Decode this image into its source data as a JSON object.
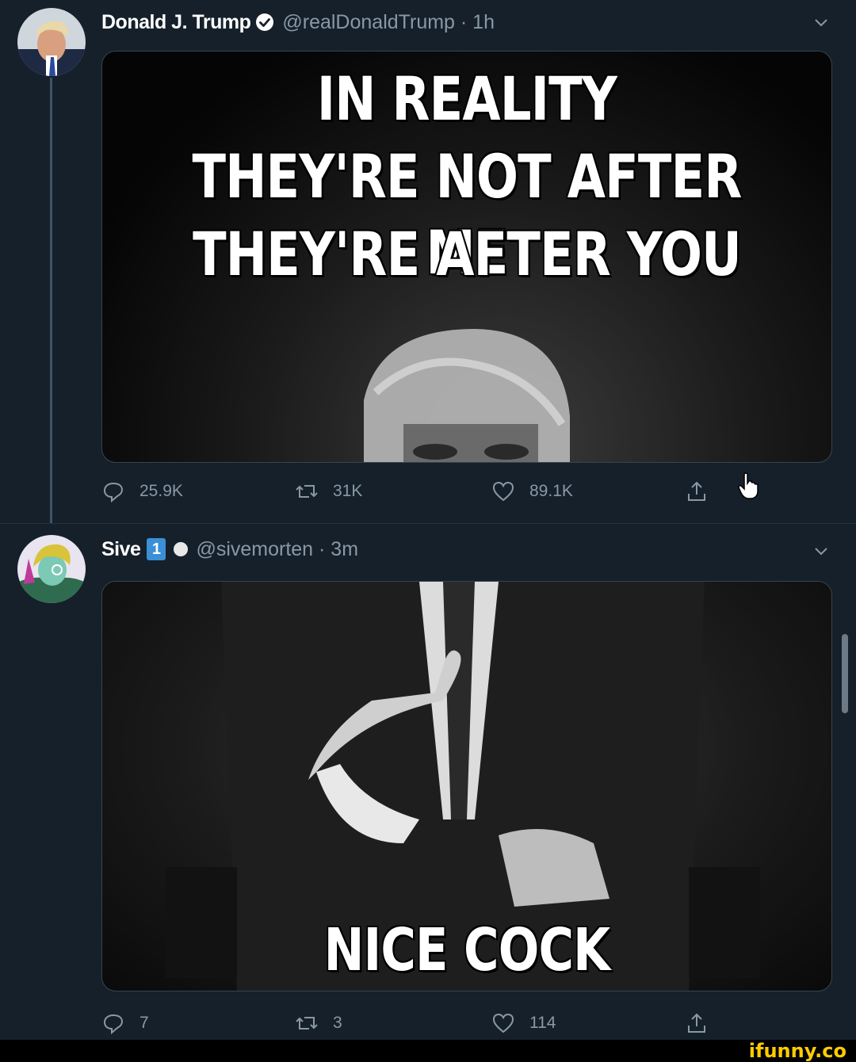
{
  "tweets": [
    {
      "name": "Donald J. Trump",
      "handle": "@realDonaldTrump · 1h",
      "meme_lines": [
        "IN REALITY",
        "THEY'RE NOT AFTER ME",
        "THEY'RE AFTER YOU"
      ],
      "replies": "25.9K",
      "retweets": "31K",
      "likes": "89.1K"
    },
    {
      "name": "Sive",
      "badge": "1",
      "handle": "@sivemorten · 3m",
      "meme_lines": [
        "NICE COCK"
      ],
      "replies": "7",
      "retweets": "3",
      "likes": "114"
    }
  ],
  "watermark": "ifunny.co",
  "colors": {
    "background": "#15202b",
    "muted_text": "#8899a6",
    "verified_blue": "#1da1f2",
    "watermark_yellow": "#ffcc00"
  }
}
